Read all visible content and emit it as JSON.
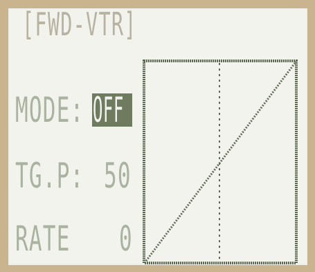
{
  "screen": {
    "title": "[FWD-VTR]",
    "mode": {
      "label": "MODE:",
      "value": "OFF"
    },
    "trigger_point": {
      "label": "TG.P:",
      "value": "50"
    },
    "rate": {
      "label": "RATE",
      "value": "0"
    }
  },
  "colors": {
    "lcd_background": "#f3f3ee",
    "pixel_on": "#5f6a55",
    "text": "#aab3a0",
    "highlight_bg": "#6e7b5f"
  }
}
